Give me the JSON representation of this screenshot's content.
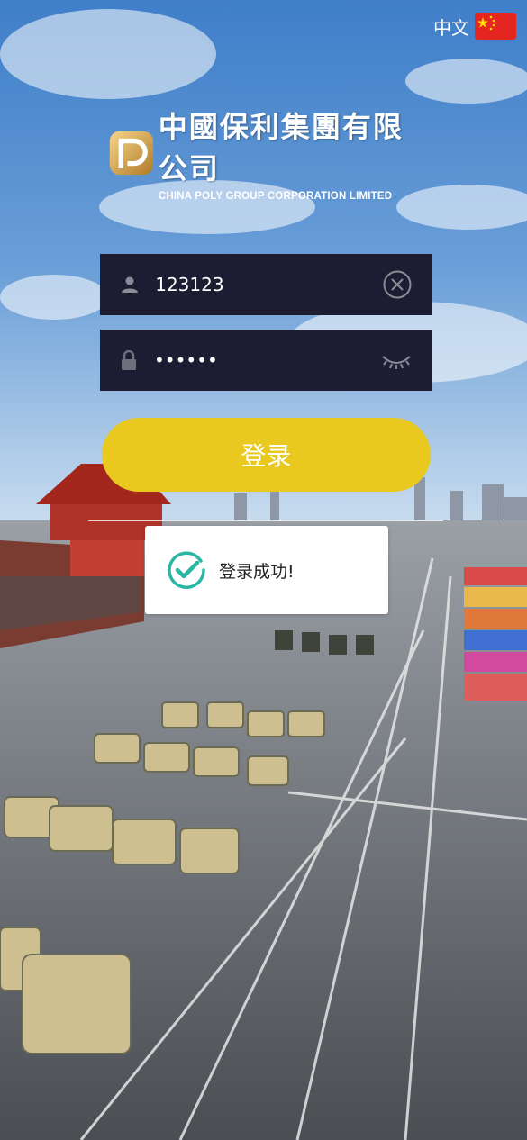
{
  "language": {
    "label": "中文",
    "flag_icon": "china-flag-icon"
  },
  "brand": {
    "name_cn": "中國保利集團有限公司",
    "name_en": "CHINA POLY GROUP CORPORATION LIMITED"
  },
  "form": {
    "username_value": "123123",
    "password_value": "••••••",
    "login_label": "登录"
  },
  "toast": {
    "message": "登录成功!"
  },
  "colors": {
    "field_bg": "#1c1d33",
    "button": "#e9c920",
    "success": "#2bb6a4"
  }
}
